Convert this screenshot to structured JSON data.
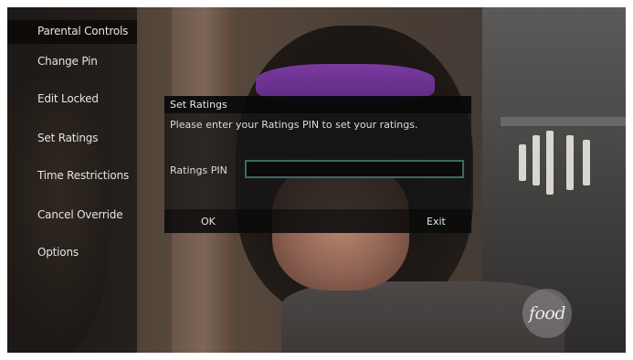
{
  "sidebar": {
    "title": "Parental Controls",
    "items": [
      {
        "label": "Change Pin"
      },
      {
        "label": "Edit Locked"
      },
      {
        "label": "Set Ratings"
      },
      {
        "label": "Time Restrictions"
      },
      {
        "label": "Cancel Override"
      },
      {
        "label": "Options"
      }
    ]
  },
  "dialog": {
    "title": "Set Ratings",
    "message": "Please enter your Ratings PIN to set your ratings.",
    "pin_label": "Ratings PIN",
    "pin_value": "",
    "ok_label": "OK",
    "exit_label": "Exit"
  },
  "channel_logo": {
    "text": "food"
  },
  "colors": {
    "pin_border": "#3a6b62",
    "headband": "#6e329a"
  }
}
